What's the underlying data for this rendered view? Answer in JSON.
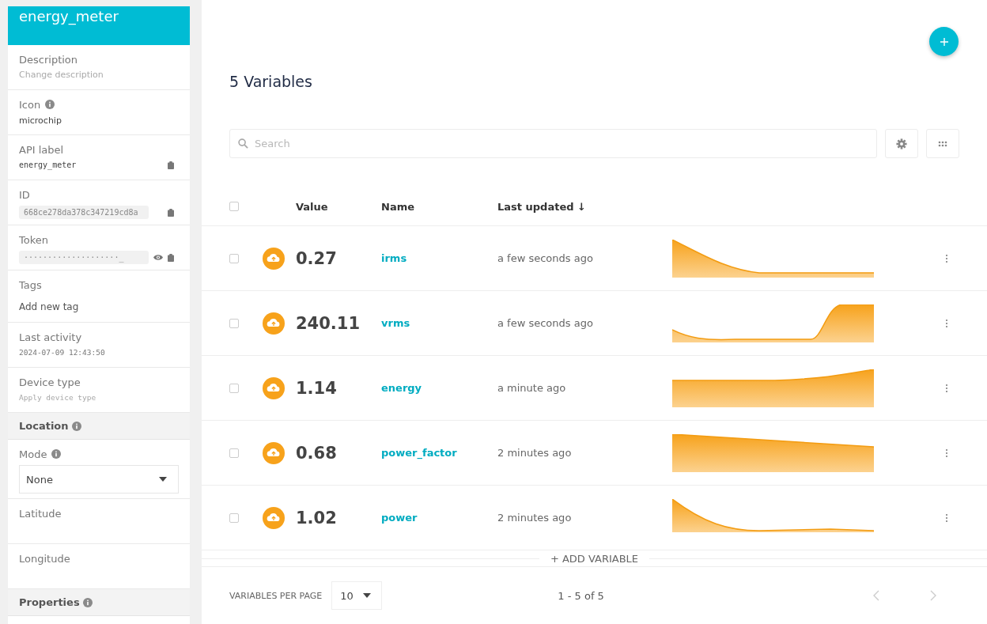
{
  "device": {
    "name": "energy_meter"
  },
  "fields": [
    {
      "kind": "hint",
      "label": "Description",
      "placeholder": "Change description"
    },
    {
      "kind": "text",
      "label": "Icon",
      "value": "microchip",
      "info": true
    },
    {
      "kind": "code",
      "label": "API label",
      "value": "energy_meter"
    },
    {
      "kind": "code-box",
      "label": "ID",
      "value": "668ce278da378c347219cd8a"
    },
    {
      "kind": "secret",
      "label": "Token",
      "value": "····················_"
    },
    {
      "kind": "tags",
      "label": "Tags",
      "value": "Add new tag"
    },
    {
      "kind": "mono",
      "label": "Last activity",
      "value": "2024-07-09 12:43:50"
    },
    {
      "kind": "mono-hint",
      "label": "Device type",
      "placeholder": "Apply device type"
    },
    {
      "kind": "section",
      "label": "Location",
      "info": true
    },
    {
      "kind": "select",
      "label": "Mode",
      "value": "None",
      "info": true
    },
    {
      "kind": "empty",
      "label": "Latitude"
    },
    {
      "kind": "empty",
      "label": "Longitude"
    },
    {
      "kind": "section",
      "label": "Properties",
      "info": true
    }
  ],
  "title": "5 Variables",
  "search": {
    "placeholder": "Search"
  },
  "table": {
    "columns": [
      "Value",
      "Name",
      "Last updated ↓"
    ],
    "header_checked": false,
    "rows": [
      {
        "value": "0.27",
        "name": "irms",
        "updated": "a few seconds ago",
        "checked": false
      },
      {
        "value": "240.11",
        "name": "vrms",
        "updated": "a few seconds ago",
        "checked": false
      },
      {
        "value": "1.14",
        "name": "energy",
        "updated": "a minute ago",
        "checked": false
      },
      {
        "value": "0.68",
        "name": "power_factor",
        "updated": "2 minutes ago",
        "checked": false
      },
      {
        "value": "1.02",
        "name": "power",
        "updated": "2 minutes ago",
        "checked": false
      }
    ]
  },
  "add_variable": "+ ADD VARIABLE",
  "footer": {
    "per_page_label": "VARIABLES PER PAGE",
    "per_page": "10",
    "range": "1 - 5 of 5"
  }
}
